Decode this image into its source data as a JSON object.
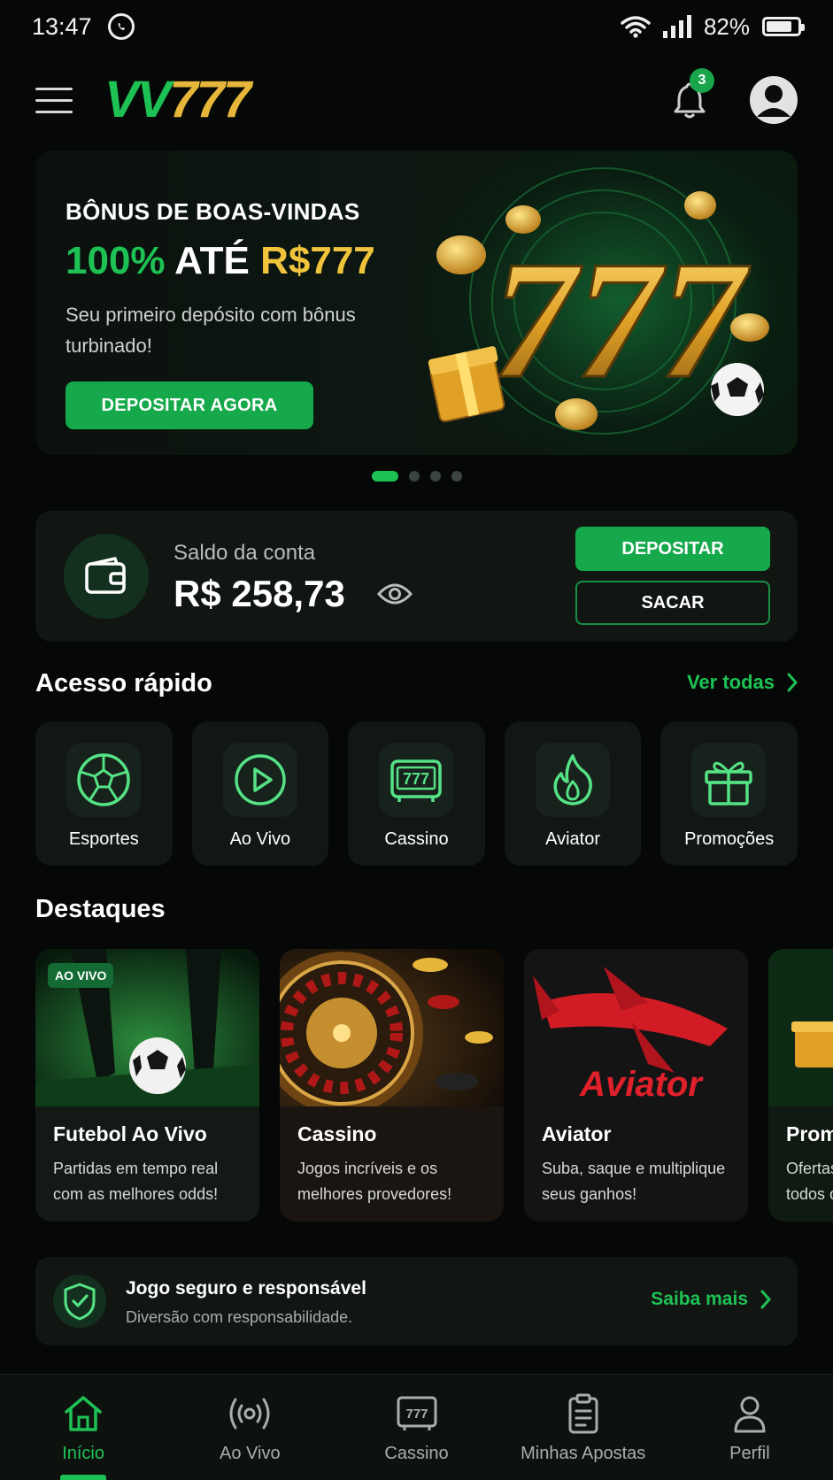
{
  "status_bar": {
    "time": "13:47",
    "battery": "82%",
    "battery_level": 0.82
  },
  "header": {
    "logo_letters": "VV",
    "logo_numbers": "777",
    "notifications_count": "3"
  },
  "banner": {
    "title": "BÔNUS DE BOAS-VINDAS",
    "headline_percent": "100%",
    "headline_middle": "ATÉ",
    "headline_amount": "R$777",
    "subtitle": "Seu primeiro depósito com bônus turbinado!",
    "cta": "DEPOSITAR AGORA",
    "slides": 4,
    "active_slide": 1
  },
  "balance": {
    "label": "Saldo da conta",
    "value": "R$ 258,73",
    "deposit_label": "DEPOSITAR",
    "withdraw_label": "SACAR"
  },
  "quick_access": {
    "title": "Acesso rápido",
    "see_all": "Ver todas",
    "items": [
      {
        "label": "Esportes",
        "icon": "soccer-ball-icon"
      },
      {
        "label": "Ao Vivo",
        "icon": "play-icon"
      },
      {
        "label": "Cassino",
        "icon": "slot-machine-icon"
      },
      {
        "label": "Aviator",
        "icon": "flame-icon"
      },
      {
        "label": "Promoções",
        "icon": "gift-icon"
      }
    ]
  },
  "highlights": {
    "title": "Destaques",
    "items": [
      {
        "title": "Futebol Ao Vivo",
        "desc": "Partidas em tempo real com as melhores odds!",
        "tag": "AO VIVO"
      },
      {
        "title": "Cassino",
        "desc": "Jogos incríveis e os melhores provedores!"
      },
      {
        "title": "Aviator",
        "desc": "Suba, saque e multiplique seus ganhos!",
        "image_text": "Aviator"
      },
      {
        "title": "Prom",
        "desc": "Ofertas todos o"
      }
    ]
  },
  "responsible": {
    "title": "Jogo seguro e responsável",
    "subtitle": "Diversão com responsabilidade.",
    "link": "Saiba mais"
  },
  "bottom_nav": [
    {
      "label": "Início",
      "icon": "home-icon",
      "active": true
    },
    {
      "label": "Ao Vivo",
      "icon": "broadcast-icon"
    },
    {
      "label": "Cassino",
      "icon": "slot-machine-icon"
    },
    {
      "label": "Minhas Apostas",
      "icon": "clipboard-icon"
    },
    {
      "label": "Perfil",
      "icon": "user-icon"
    }
  ],
  "colors": {
    "accent": "#1ec254",
    "gold": "#f0c33c",
    "background": "#050806",
    "card": "#111613"
  }
}
